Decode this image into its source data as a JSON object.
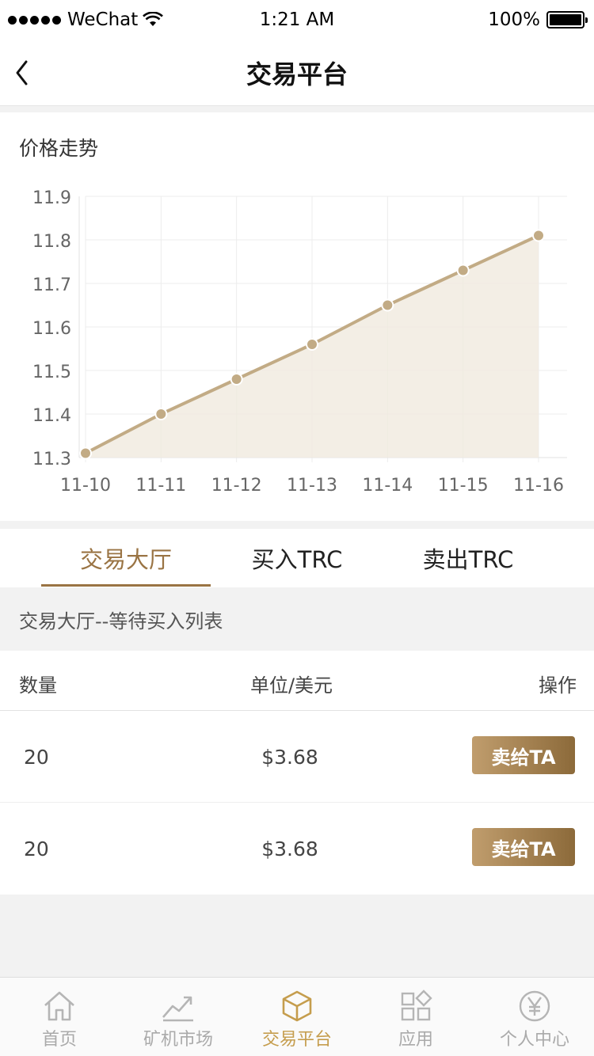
{
  "status_bar": {
    "carrier": "WeChat",
    "time": "1:21 AM",
    "battery": "100%"
  },
  "nav": {
    "title": "交易平台"
  },
  "chart_section": {
    "title": "价格走势"
  },
  "chart_data": {
    "type": "area",
    "x": [
      "11-10",
      "11-11",
      "11-12",
      "11-13",
      "11-14",
      "11-15",
      "11-16"
    ],
    "values": [
      11.31,
      11.4,
      11.48,
      11.56,
      11.65,
      11.73,
      11.81
    ],
    "y_ticks": [
      "11.9",
      "11.8",
      "11.7",
      "11.6",
      "11.5",
      "11.4",
      "11.3"
    ],
    "ylim": [
      11.3,
      11.9
    ],
    "grid": true,
    "colors": {
      "line": "#c2ab85",
      "fill": "#f1ebe0",
      "point": "#c2ab85"
    }
  },
  "tabs": [
    {
      "label": "交易大厅",
      "active": true
    },
    {
      "label": "买入TRC",
      "active": false
    },
    {
      "label": "卖出TRC",
      "active": false
    }
  ],
  "section_header": "交易大厅--等待买入列表",
  "table": {
    "headers": {
      "qty": "数量",
      "price": "单位/美元",
      "action": "操作"
    },
    "rows": [
      {
        "qty": "20",
        "price": "$3.68",
        "action": "卖给TA"
      },
      {
        "qty": "20",
        "price": "$3.68",
        "action": "卖给TA"
      }
    ]
  },
  "tabbar": [
    {
      "label": "首页",
      "icon": "home-icon",
      "active": false
    },
    {
      "label": "矿机市场",
      "icon": "chart-icon",
      "active": false
    },
    {
      "label": "交易平台",
      "icon": "cube-icon",
      "active": true
    },
    {
      "label": "应用",
      "icon": "apps-icon",
      "active": false
    },
    {
      "label": "个人中心",
      "icon": "yen-icon",
      "active": false
    }
  ],
  "colors": {
    "accent": "#9a7444",
    "tab_active": "#c59d4d",
    "tab_inactive": "#aaaaaa"
  }
}
